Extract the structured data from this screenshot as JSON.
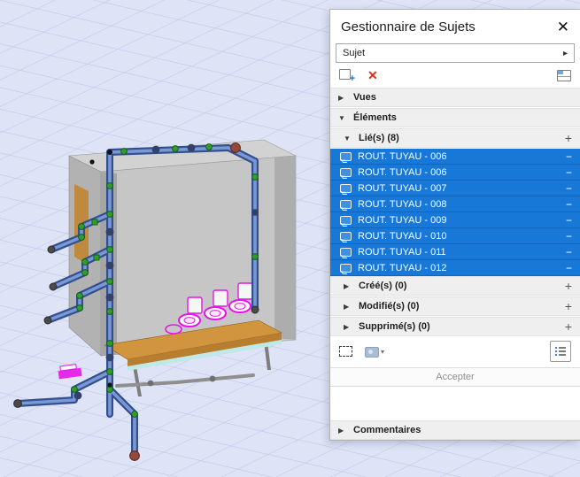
{
  "panel": {
    "title": "Gestionnaire de Sujets",
    "filter": {
      "value": "Sujet"
    },
    "icons": {
      "close": "✕",
      "combo_arrow": "▸",
      "delete": "✕",
      "add_plus": "+",
      "collapsed": "▶",
      "expanded": "▼",
      "plus": "+",
      "minus": "−",
      "caret_down": "▾"
    },
    "sections": {
      "vues": {
        "label": "Vues"
      },
      "elements": {
        "label": "Éléments"
      },
      "liees": {
        "label": "Lié(s) (8)"
      },
      "crees": {
        "label": "Créé(s) (0)"
      },
      "modifies": {
        "label": "Modifié(s) (0)"
      },
      "supprimes": {
        "label": "Supprimé(s) (0)"
      },
      "commentaires": {
        "label": "Commentaires"
      }
    },
    "items": [
      "ROUT. TUYAU - 006",
      "ROUT. TUYAU - 006",
      "ROUT. TUYAU - 007",
      "ROUT. TUYAU - 008",
      "ROUT. TUYAU - 009",
      "ROUT. TUYAU - 010",
      "ROUT. TUYAU - 011",
      "ROUT. TUYAU - 012"
    ],
    "accept_label": "Accepter"
  },
  "colors": {
    "selection_blue": "#1878d8",
    "viewport_background": "#dee3f5",
    "grid_line": "#b9c3e6",
    "pipe_blue": "#3a5a9e",
    "fitting_green": "#2f9e2f",
    "fixture_magenta": "#e714e7",
    "table_orange": "#d2953f",
    "delete_red": "#e03010"
  }
}
